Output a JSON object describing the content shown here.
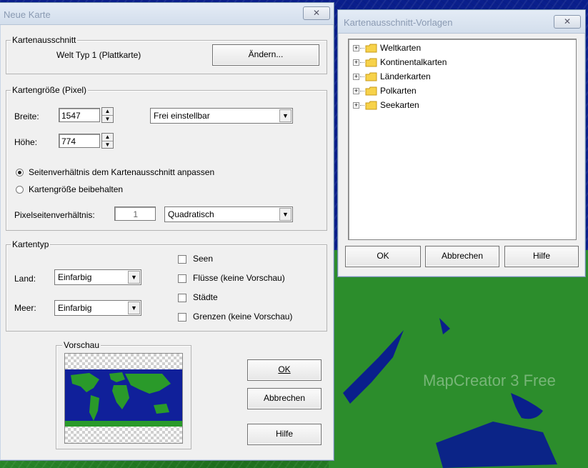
{
  "background": {
    "watermark": "MapCreator 3 Free",
    "colors": {
      "water": "#0a1f8c",
      "land": "#2a8a2a"
    }
  },
  "dialog_main": {
    "title": "Neue Karte",
    "close_label": "✕",
    "section_ausschnitt": {
      "label": "Kartenausschnitt",
      "value": "Welt Typ 1 (Plattkarte)",
      "change_button": "Ändern..."
    },
    "section_size": {
      "label": "Kartengröße (Pixel)",
      "width_label": "Breite:",
      "width_value": "1547",
      "height_label": "Höhe:",
      "height_value": "774",
      "mode_select": "Frei einstellbar",
      "radio_adapt": "Seitenverhältnis dem Kartenausschnitt anpassen",
      "radio_keep": "Kartengröße beibehalten",
      "radio_selected": "adapt",
      "pixel_ratio_label": "Pixelseitenverhältnis:",
      "pixel_ratio_value": "1",
      "pixel_ratio_select": "Quadratisch"
    },
    "section_type": {
      "label": "Kartentyp",
      "land_label": "Land:",
      "land_value": "Einfarbig",
      "sea_label": "Meer:",
      "sea_value": "Einfarbig",
      "checkboxes": [
        {
          "label": "Seen",
          "checked": false
        },
        {
          "label": "Flüsse (keine Vorschau)",
          "checked": false
        },
        {
          "label": "Städte",
          "checked": false
        },
        {
          "label": "Grenzen (keine Vorschau)",
          "checked": false
        }
      ]
    },
    "preview": {
      "label": "Vorschau"
    },
    "buttons": {
      "ok": "OK",
      "cancel": "Abbrechen",
      "help": "Hilfe"
    }
  },
  "dialog_templates": {
    "title": "Kartenausschnitt-Vorlagen",
    "close_label": "✕",
    "tree_items": [
      {
        "label": "Weltkarten"
      },
      {
        "label": "Kontinentalkarten"
      },
      {
        "label": "Länderkarten"
      },
      {
        "label": "Polkarten"
      },
      {
        "label": "Seekarten"
      }
    ],
    "buttons": {
      "ok": "OK",
      "cancel": "Abbrechen",
      "help": "Hilfe"
    }
  }
}
